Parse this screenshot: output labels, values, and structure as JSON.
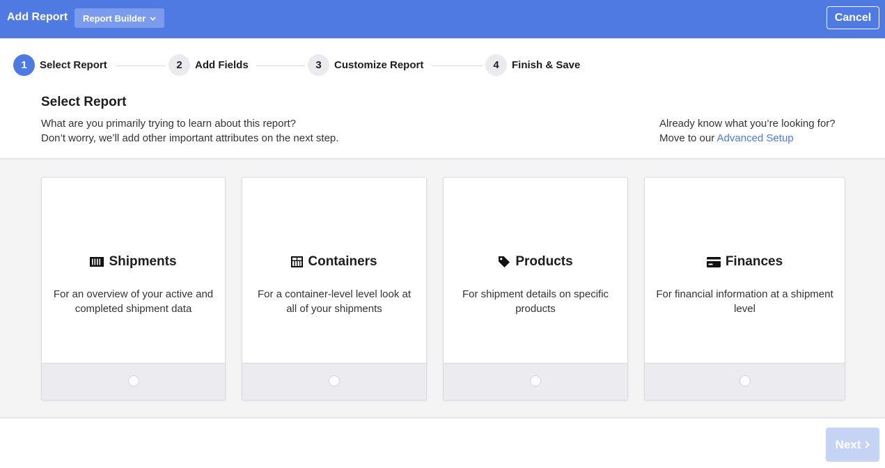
{
  "header": {
    "title": "Add Report",
    "dropdown_label": "Report Builder",
    "cancel_label": "Cancel",
    "brand_color": "#4e7ae2"
  },
  "steps": [
    {
      "number": "1",
      "label": "Select Report",
      "active": true
    },
    {
      "number": "2",
      "label": "Add Fields",
      "active": false
    },
    {
      "number": "3",
      "label": "Customize Report",
      "active": false
    },
    {
      "number": "4",
      "label": "Finish & Save",
      "active": false
    }
  ],
  "intro": {
    "title": "Select Report",
    "line1": "What are you primarily trying to learn about this report?",
    "line2": "Don’t worry, we’ll add other important attributes on the next step.",
    "advanced_line1": "Already know what you’re looking for?",
    "advanced_prefix": "Move to our ",
    "advanced_link": "Advanced Setup"
  },
  "cards": [
    {
      "title": "Shipments",
      "icon": "barcode-icon",
      "description": "For an overview of your active and completed shipment data"
    },
    {
      "title": "Containers",
      "icon": "container-icon",
      "description": "For a container-level level look at all of your shipments"
    },
    {
      "title": "Products",
      "icon": "tag-icon",
      "description": "For shipment details on specific products"
    },
    {
      "title": "Finances",
      "icon": "credit-card-icon",
      "description": "For financial information at a shipment level"
    }
  ],
  "footer": {
    "next_label": "Next"
  }
}
